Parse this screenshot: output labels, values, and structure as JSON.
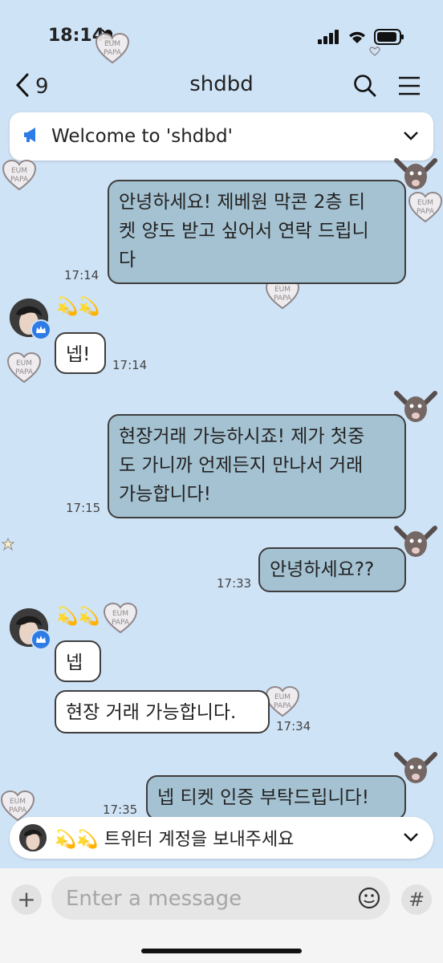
{
  "status": {
    "time": "18:14"
  },
  "header": {
    "back_count": "9",
    "title": "shdbd"
  },
  "notice": {
    "text": "Welcome to 'shdbd'"
  },
  "colors": {
    "outgoing_bubble": "#a5c2d2",
    "incoming_bubble": "#ffffff",
    "background": "#cfe3f6",
    "crown_badge": "#2e7be6"
  },
  "messages": [
    {
      "direction": "out",
      "lines": [
        "안녕하세요! 제베원 막콘 2층 티",
        "켓 양도 받고 싶어서 연락 드립니",
        "다"
      ],
      "time": "17:14"
    },
    {
      "direction": "in",
      "sender": "💫💫",
      "lines": [
        "넵!"
      ],
      "time": "17:14"
    },
    {
      "direction": "out",
      "lines": [
        "현장거래 가능하시죠! 제가 첫중",
        "도 가니까 언제든지 만나서 거래",
        "가능합니다!"
      ],
      "time": "17:15"
    },
    {
      "direction": "out",
      "lines": [
        "안녕하세요??"
      ],
      "time": "17:33"
    },
    {
      "direction": "in",
      "sender": "💫💫",
      "lines": [
        "넵"
      ],
      "time": ""
    },
    {
      "direction": "in",
      "lines": [
        "현장 거래 가능합니다."
      ],
      "time": "17:34"
    },
    {
      "direction": "out",
      "lines": [
        "넵 티켓 인증 부탁드립니다!"
      ],
      "time": "17:35"
    }
  ],
  "stickers": {
    "eum_line1": "EUM",
    "eum_line2": "PAPA"
  },
  "pinned": {
    "text": "💫💫 트위터 계정을 보내주세요"
  },
  "composer": {
    "placeholder": "Enter a message",
    "hash": "#",
    "plus": "+"
  }
}
